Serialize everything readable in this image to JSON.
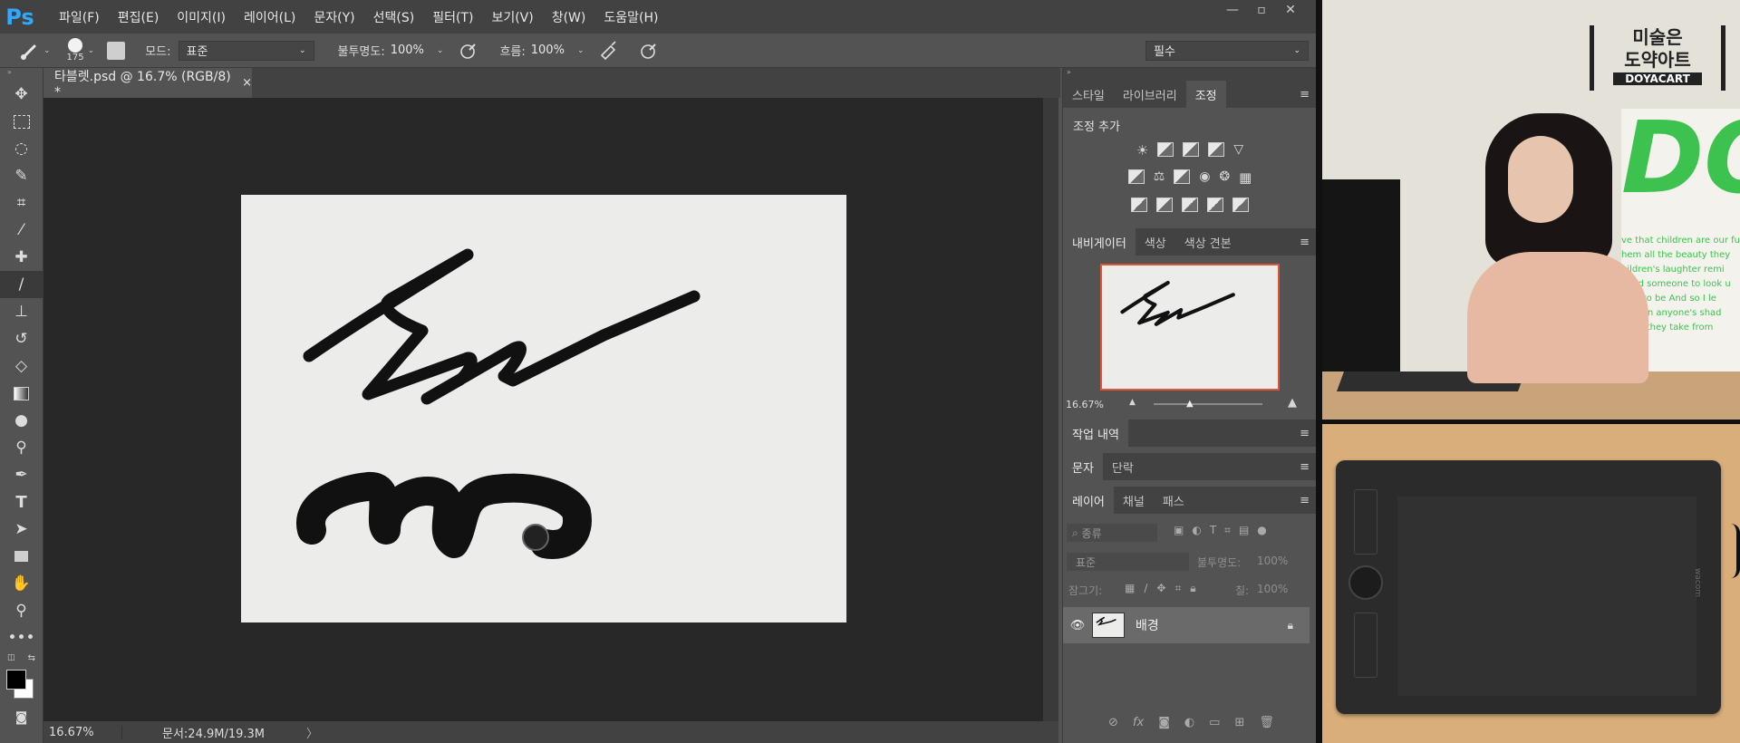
{
  "app": {
    "logo": "Ps",
    "menus": [
      "파일(F)",
      "편집(E)",
      "이미지(I)",
      "레이어(L)",
      "문자(Y)",
      "선택(S)",
      "필터(T)",
      "보기(V)",
      "창(W)",
      "도움말(H)"
    ],
    "window_controls": [
      "—",
      "▫",
      "✕"
    ]
  },
  "options": {
    "brush_size": "175",
    "mode_label": "모드:",
    "mode_value": "표준",
    "opacity_label": "불투명도:",
    "opacity_value": "100%",
    "flow_label": "흐름:",
    "flow_value": "100%",
    "workspace": "필수"
  },
  "document": {
    "tab_title": "타블렛.psd @ 16.7% (RGB/8) *",
    "close": "×"
  },
  "status": {
    "zoom": "16.67%",
    "doc_info": "문서:24.9M/19.3M",
    "arrow": "〉"
  },
  "panels": {
    "group1_tabs": [
      "스타일",
      "라이브러리",
      "조정"
    ],
    "adjust_title": "조정 추가",
    "group2_tabs": [
      "내비게이터",
      "색상",
      "색상 견본"
    ],
    "nav_zoom": "16.67%",
    "history": "작업 내역",
    "type_tabs": [
      "문자",
      "단락"
    ],
    "layer_tabs": [
      "레이어",
      "채널",
      "패스"
    ],
    "layer_filter": "종류",
    "blend_mode": "표준",
    "opacity_label": "불투명도:",
    "opacity_value": "100%",
    "lock_label": "잠그기:",
    "fill_label": "칠:",
    "fill_value": "100%",
    "layer_name": "배경",
    "footer_icons": [
      "fx"
    ]
  },
  "video": {
    "brand_line1": "미술은",
    "brand_line2": "도약아트",
    "brand_en": "DOYACART",
    "banner_text": "DO",
    "poster_lines": [
      "ve that children are our fu",
      "hem all the beauty they",
      "hildren's laughter remi",
      "eded someone to look u",
      "lace to be And so I le",
      "walk in anyone's shad",
      "what they take from"
    ],
    "tablet_brand": "wacom"
  },
  "colors": {
    "accent": "#31a8ff",
    "nav_frame": "#e0553a",
    "banner_green": "#3ec24f"
  }
}
